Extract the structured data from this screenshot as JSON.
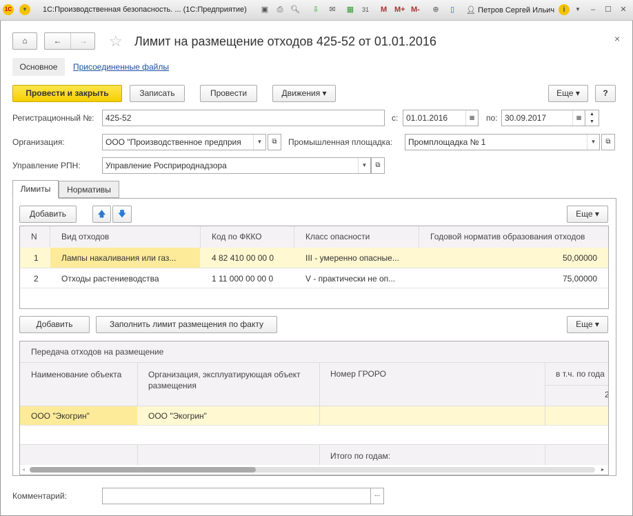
{
  "titlebar": {
    "app_title": "1С:Производственная безопасность. ...  (1С:Предприятие)",
    "user": "Петров Сергей Ильич",
    "m": "M",
    "mplus": "M+",
    "mminus": "M-"
  },
  "form": {
    "title": "Лимит на размещение отходов 425-52 от 01.01.2016",
    "nav_tabs": [
      "Основное",
      "Присоединенные файлы"
    ],
    "toolbar": {
      "post_close": "Провести и закрыть",
      "save": "Записать",
      "post": "Провести",
      "movements": "Движения",
      "more": "Еще",
      "help": "?"
    },
    "reg_label": "Регистрационный №:",
    "reg_value": "425-52",
    "from_label": "с:",
    "from_value": "01.01.2016",
    "to_label": "по:",
    "to_value": "30.09.2017",
    "org_label": "Организация:",
    "org_value": "ООО \"Производственное предприя",
    "site_label": "Промышленная площадка:",
    "site_value": "Промплощадка № 1",
    "rpn_label": "Управление РПН:",
    "rpn_value": "Управление Росприроднадзора",
    "tabs": [
      "Лимиты",
      "Нормативы"
    ],
    "limits": {
      "add": "Добавить",
      "more": "Еще",
      "columns": [
        "N",
        "Вид отходов",
        "Код по ФККО",
        "Класс опасности",
        "Годовой норматив образования отходов"
      ],
      "rows": [
        [
          "1",
          "Лампы накаливания или газ...",
          "4 82 410 00 00 0",
          "III - умеренно опасные...",
          "50,00000"
        ],
        [
          "2",
          "Отходы растениеводства",
          "1 11 000 00 00 0",
          "V - практически не оп...",
          "75,00000"
        ]
      ]
    },
    "transfer": {
      "add": "Добавить",
      "fill": "Заполнить лимит размещения по факту",
      "more": "Еще",
      "group_header": "Передача отходов на размещение",
      "columns": [
        "Наименование объекта",
        "Организация, эксплуатирующая объект размещения",
        "Номер ГРОРО",
        "в т.ч. по года"
      ],
      "subheader": "2",
      "rows": [
        [
          "ООО \"Экогрин\"",
          "ООО \"Экогрин\"",
          "",
          ""
        ]
      ],
      "footer": "Итого по годам:",
      "scroll_fraction": 0.4
    },
    "comment_label": "Комментарий:",
    "comment_value": "",
    "ellipsis": "..."
  }
}
